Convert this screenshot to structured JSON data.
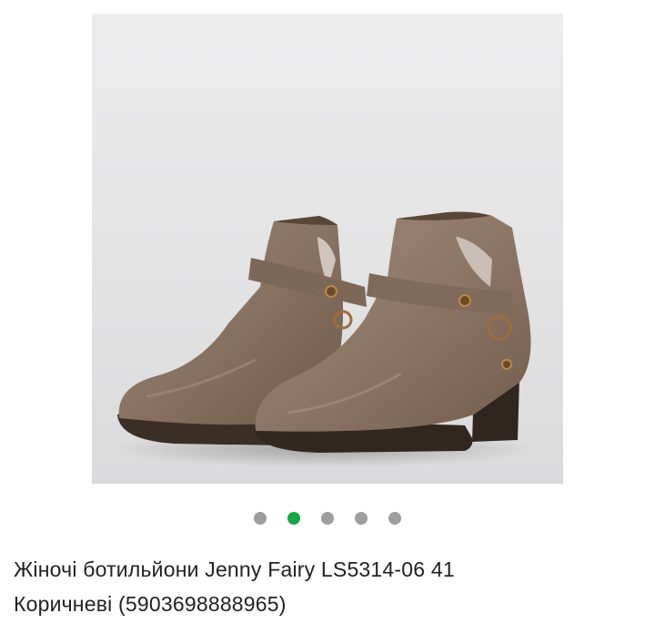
{
  "product": {
    "image": {
      "description_icon": "ankle-boots-photo",
      "background_color": "#e6e6e7",
      "boot_color": "#8b7363"
    },
    "carousel": {
      "dot_count": 5,
      "active_index": 1,
      "active_color": "#19a34a",
      "inactive_color": "#9e9e9e"
    },
    "title_line1": "Жіночі ботильйони Jenny Fairy LS5314-06 41",
    "title_line2": "Коричневі (5903698888965)"
  }
}
